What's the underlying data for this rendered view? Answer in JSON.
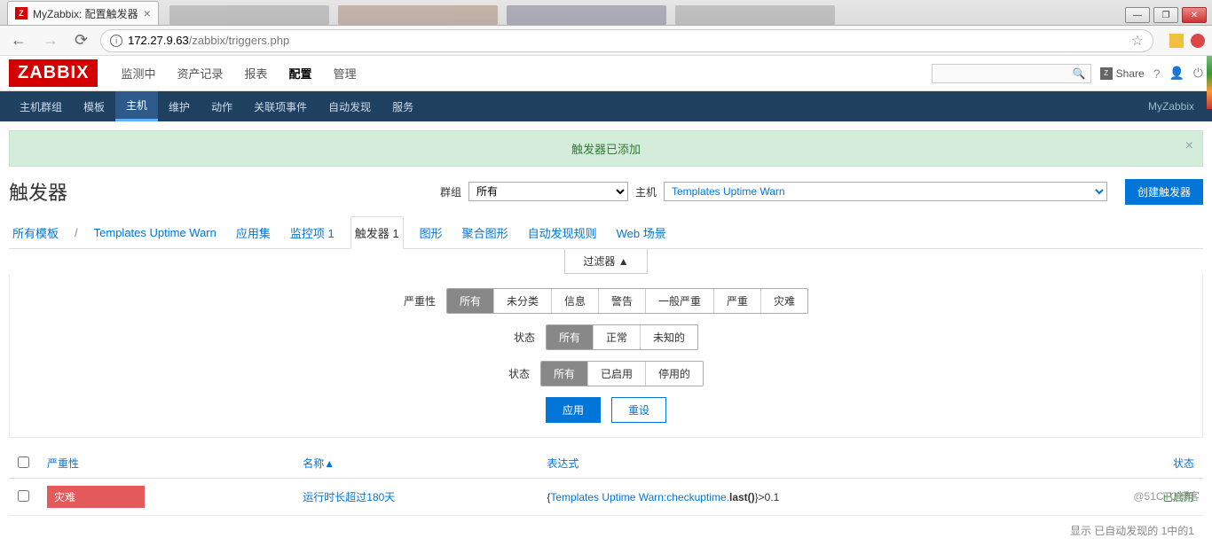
{
  "browser": {
    "tab_title": "MyZabbix: 配置触发器",
    "url_host": "172.27.9.63",
    "url_path": "/zabbix/triggers.php"
  },
  "window_controls": {
    "min": "—",
    "max": "❐",
    "close": "✕"
  },
  "header": {
    "logo": "ZABBIX",
    "nav": [
      "监测中",
      "资产记录",
      "报表",
      "配置",
      "管理"
    ],
    "nav_active": 3,
    "share": "Share",
    "search_icon": "🔍"
  },
  "subnav": {
    "items": [
      "主机群组",
      "模板",
      "主机",
      "维护",
      "动作",
      "关联项事件",
      "自动发现",
      "服务"
    ],
    "active": 2,
    "right": "MyZabbix"
  },
  "alert": {
    "text": "触发器已添加",
    "close": "×"
  },
  "page": {
    "title": "触发器",
    "group_label": "群组",
    "group_value": "所有",
    "host_label": "主机",
    "host_value": "Templates Uptime Warn",
    "create_btn": "创建触发器"
  },
  "tabs": {
    "all_templates": "所有模板",
    "sep": "/",
    "template_name": "Templates Uptime Warn",
    "items": [
      "应用集",
      "监控项 1",
      "触发器 1",
      "图形",
      "聚合图形",
      "自动发现规则",
      "Web 场景"
    ],
    "active": 2
  },
  "filter": {
    "toggle": "过滤器 ▲",
    "severity_label": "严重性",
    "severity_opts": [
      "所有",
      "未分类",
      "信息",
      "警告",
      "一般严重",
      "严重",
      "灾难"
    ],
    "state_label": "状态",
    "state_opts": [
      "所有",
      "正常",
      "未知的"
    ],
    "status_label": "状态",
    "status_opts": [
      "所有",
      "已启用",
      "停用的"
    ],
    "apply": "应用",
    "reset": "重设"
  },
  "table": {
    "headers": {
      "severity": "严重性",
      "name": "名称▲",
      "expression": "表达式",
      "status": "状态"
    },
    "rows": [
      {
        "severity": "灾难",
        "name": "运行时长超过180天",
        "expr_prefix": "{",
        "expr_link": "Templates Uptime Warn:checkuptime.",
        "expr_bold": "last()",
        "expr_suffix": "}>0.1",
        "status": "已启用"
      }
    ],
    "footer": "显示 已自动发现的 1中的1"
  },
  "watermark": "@51CTO博客"
}
